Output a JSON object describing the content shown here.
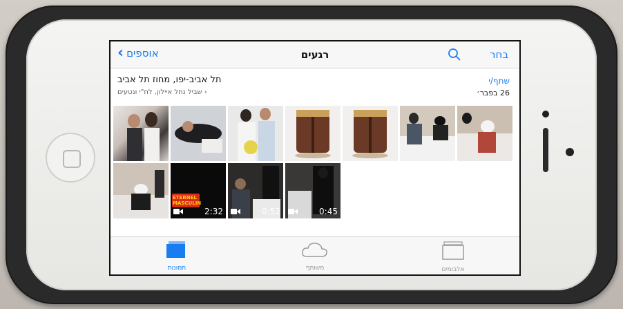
{
  "nav": {
    "back_label": "אוספים",
    "title": "רגעים",
    "select_label": "בחר"
  },
  "moment": {
    "location_title": "תל אביב-יפו, מחוז תל אביב",
    "location_subtitle": "שביל נחל איילון, לח\"י ונטעים",
    "share_label": "שתף/י",
    "date": "26 בפבר׳"
  },
  "videos": [
    {
      "duration": "2:32",
      "caption": "ETERNEL MASCULIN"
    },
    {
      "duration": "0:52"
    },
    {
      "duration": "0:45"
    }
  ],
  "tabs": [
    {
      "label": "תמונות",
      "icon": "photos-icon",
      "active": true
    },
    {
      "label": "משותף",
      "icon": "cloud-icon",
      "active": false
    },
    {
      "label": "אלבומים",
      "icon": "albums-icon",
      "active": false
    }
  ],
  "colors": {
    "accent": "#1a7cf0",
    "case": "#2b2a2a"
  }
}
